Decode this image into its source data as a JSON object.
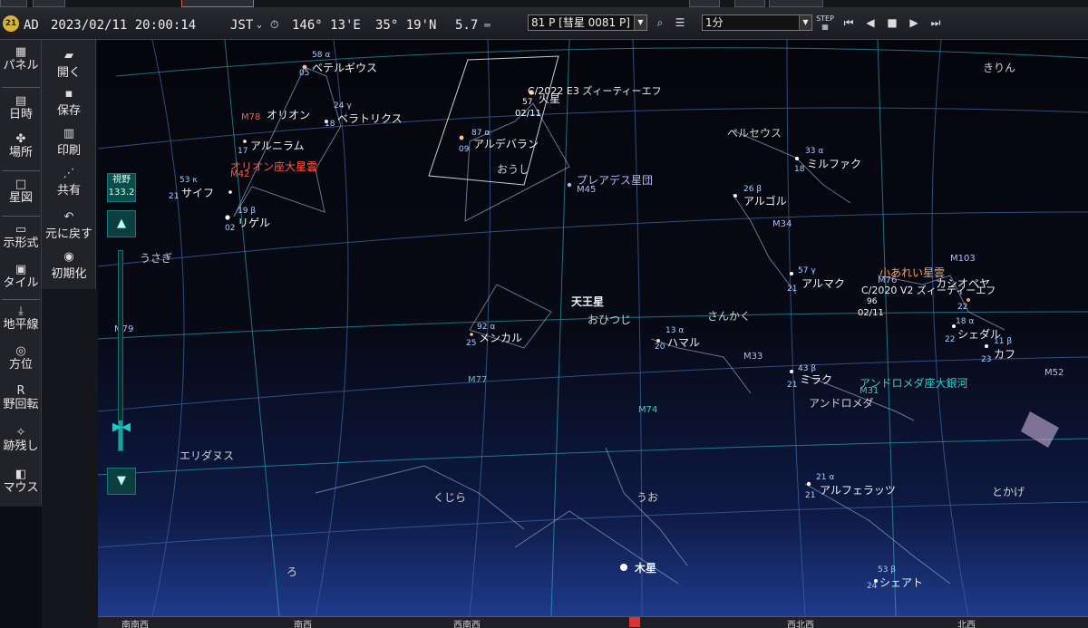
{
  "status": {
    "era": "AD",
    "datetime": "2023/02/11 20:00:14",
    "timezone": "JST",
    "timezone_chevron": "⌄",
    "longitude": "146° 13'E",
    "latitude": "35° 19'N",
    "magnitude": "5.7",
    "target_select": "81 P [彗星 0081 P]",
    "step_select": "1分"
  },
  "toolbar_left": [
    {
      "icon": "panel-icon",
      "label": "パネル"
    },
    {
      "icon": "datetime-icon",
      "label": "日時"
    },
    {
      "icon": "location-icon",
      "label": "場所"
    },
    {
      "icon": "starchart-icon",
      "label": "星図"
    },
    {
      "icon": "display-format-icon",
      "label": "示形式"
    },
    {
      "icon": "style-icon",
      "label": "タイル"
    },
    {
      "icon": "horizon-icon",
      "label": "地平線"
    },
    {
      "icon": "direction-icon",
      "label": "方位"
    },
    {
      "icon": "fov-rotate-icon",
      "label": "野回転"
    },
    {
      "icon": "trail-icon",
      "label": "跡残し"
    },
    {
      "icon": "mouse-icon",
      "label": "マウス"
    }
  ],
  "toolbar_file": [
    {
      "icon": "open-icon",
      "label": "開く"
    },
    {
      "icon": "save-icon",
      "label": "保存"
    },
    {
      "icon": "print-icon",
      "label": "印刷"
    },
    {
      "icon": "share-icon",
      "label": "共有"
    },
    {
      "icon": "undo-icon",
      "label": "元に戻す"
    },
    {
      "icon": "reset-icon",
      "label": "初期化"
    }
  ],
  "zoom": {
    "label": "視野",
    "value": "133.2",
    "level": 0.15
  },
  "sky_labels": {
    "betelgeuse": "ベテルギウス",
    "betelgeuse_num": "58 α",
    "orion": "オリオン",
    "bellatrix": "ベラトリクス",
    "bellatrix_num": "24 γ",
    "alnilam": "アルニラム",
    "orion_nebula": "オリオン座大星雲",
    "m42": "M42",
    "saiph": "サイフ",
    "saiph_num": "53 κ",
    "rigel": "リゲル",
    "rigel_num": "19 β",
    "comet_e3": "C/2022 E3 ズィーティーエフ",
    "comet_e3_date": "02/11",
    "comet_e3_mag": "57",
    "mars": "火星",
    "aldebaran": "アルデバラン",
    "aldebaran_num": "87 α",
    "auriga": "おうし",
    "pleiades": "プレアデス星団",
    "m45": "M45",
    "perseus": "ペルセウス",
    "mirfak": "ミルファク",
    "mirfak_num": "33 α",
    "algol": "アルゴル",
    "algol_num": "26 β",
    "m34": "M34",
    "uranus": "天王星",
    "aries": "おひつじ",
    "triangulum": "さんかく",
    "menkar": "メンカル",
    "menkar_num": "92 α",
    "hamal": "ハマル",
    "hamal_num": "13 α",
    "m33": "M33",
    "mirach": "ミラク",
    "mirach_num": "43 β",
    "andromeda_galaxy": "アンドロメダ座大銀河",
    "m31": "M31",
    "andromeda": "アンドロメダ",
    "alpheratz": "アルフェラッツ",
    "alpheratz_num": "21 α",
    "alpharatz2": "アルマク",
    "almak_num": "57 γ",
    "little_dumbbell": "小あれい星雲",
    "m76": "M76",
    "comet_v2": "C/2020 V2 ズィーティーエフ",
    "comet_v2_mag": "96",
    "comet_v2_date": "02/11",
    "cassiopeia": "カシオペヤ",
    "schedar": "シェダル",
    "schedar_num": "18 α",
    "caph": "カフ",
    "caph_num": "11 β",
    "m103": "M103",
    "m52": "M52",
    "giraffe": "きりん",
    "lepus": "うさぎ",
    "eridanus": "エリダヌス",
    "cetus": "くじら",
    "pisces": "うお",
    "lacerta": "とかげ",
    "jupiter": "木星",
    "scheat": "シェアト",
    "scheat_num": "53 β",
    "m77": "M77",
    "m74": "M74",
    "m79": "M79",
    "m78": "M78",
    "fornax": "ろ",
    "kirin_num": "",
    "num_05": "05",
    "num_18": "18",
    "num_17": "17",
    "num_21a": "21",
    "num_02": "02",
    "num_09": "09",
    "num_25": "25",
    "num_20": "20",
    "num_22": "22",
    "num_23": "23",
    "num_24": "24"
  },
  "horizon_labels": [
    "南南西",
    "南西",
    "西南西",
    "西北西",
    "北西"
  ]
}
